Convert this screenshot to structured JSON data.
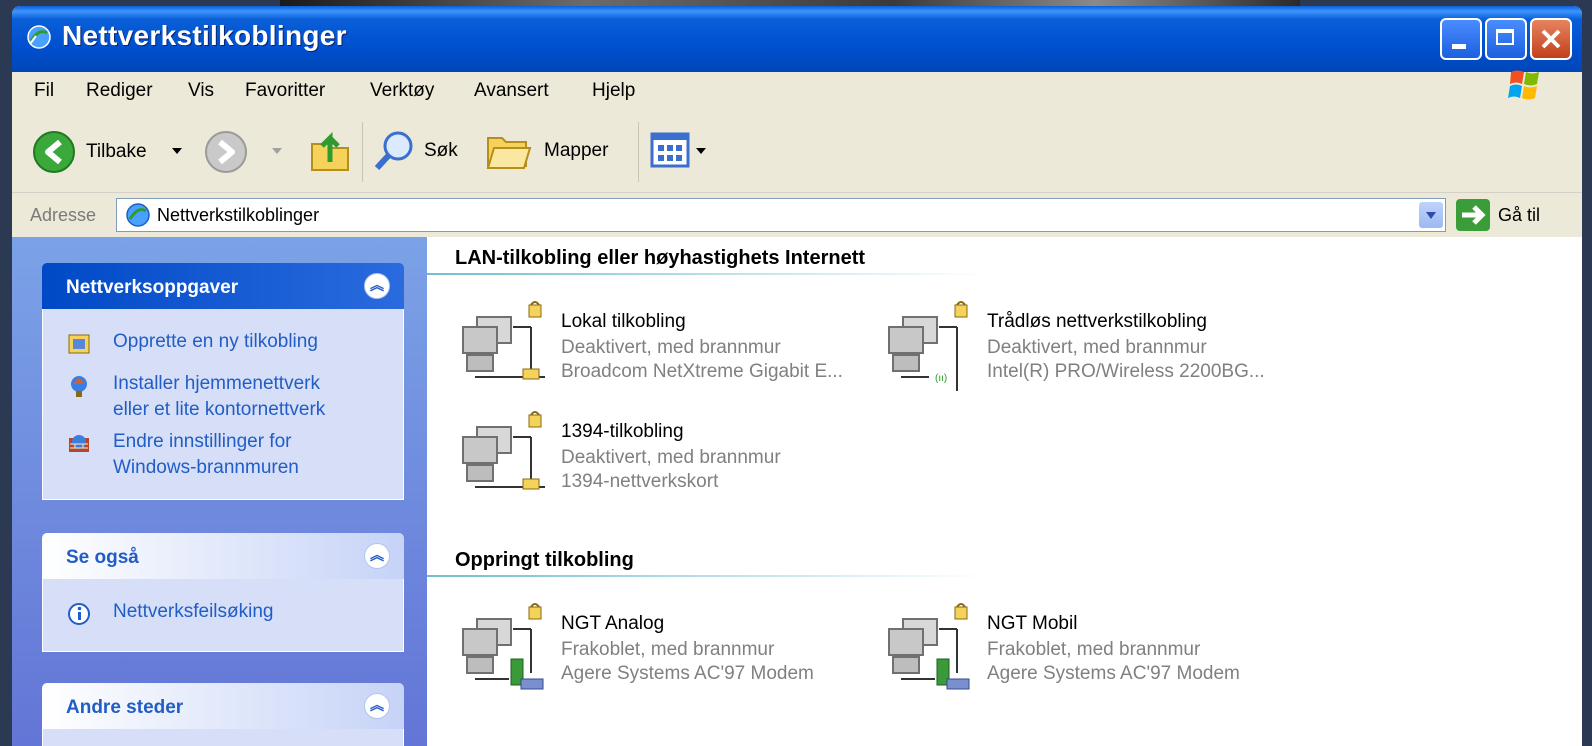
{
  "window": {
    "title": "Nettverkstilkoblinger"
  },
  "menu": [
    "Fil",
    "Rediger",
    "Vis",
    "Favoritter",
    "Verktøy",
    "Avansert",
    "Hjelp"
  ],
  "toolbar": {
    "back": "Tilbake",
    "search": "Søk",
    "folders": "Mapper"
  },
  "address": {
    "label": "Adresse",
    "value": "Nettverkstilkoblinger",
    "go": "Gå til"
  },
  "sidebar": {
    "network_tasks": {
      "title": "Nettverksoppgaver",
      "items": [
        {
          "label_line1": "Opprette en ny tilkobling",
          "label_line2": ""
        },
        {
          "label_line1": "Installer hjemmenettverk",
          "label_line2": "eller et lite kontornettverk"
        },
        {
          "label_line1": "Endre innstillinger for",
          "label_line2": "Windows-brannmuren"
        }
      ]
    },
    "see_also": {
      "title": "Se også",
      "items": [
        "Nettverksfeilsøking"
      ]
    },
    "other_places": {
      "title": "Andre steder"
    }
  },
  "groups": [
    {
      "title": "LAN-tilkobling eller høyhastighets Internett",
      "connections": [
        {
          "name": "Lokal tilkobling",
          "status": "Deaktivert, med brannmur",
          "device": "Broadcom NetXtreme Gigabit E..."
        },
        {
          "name": "Trådløs nettverkstilkobling",
          "status": "Deaktivert, med brannmur",
          "device": "Intel(R) PRO/Wireless 2200BG..."
        },
        {
          "name": "1394-tilkobling",
          "status": "Deaktivert, med brannmur",
          "device": "1394-nettverkskort"
        }
      ]
    },
    {
      "title": "Oppringt tilkobling",
      "connections": [
        {
          "name": "NGT Analog",
          "status": "Frakoblet, med brannmur",
          "device": "Agere Systems AC'97 Modem"
        },
        {
          "name": "NGT Mobil",
          "status": "Frakoblet, med brannmur",
          "device": "Agere Systems AC'97 Modem"
        }
      ]
    }
  ]
}
